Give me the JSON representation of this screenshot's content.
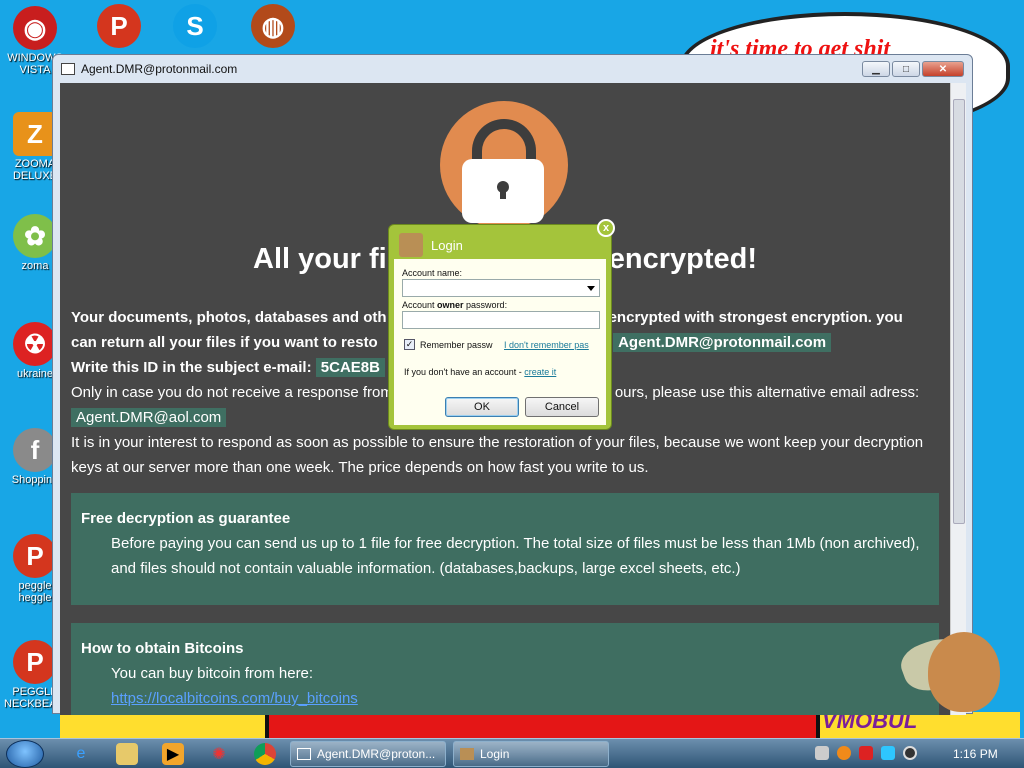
{
  "desktop": {
    "icons": [
      {
        "label": "WINDOWS VISTA",
        "glyph": "◉",
        "color": "#c81e1e"
      },
      {
        "label": "ZOOMA DELUXE",
        "glyph": "Z",
        "color": "#e8921a"
      },
      {
        "label": "zoma",
        "glyph": "✿",
        "color": "#7fbf4a"
      },
      {
        "label": "ukraine",
        "glyph": "☢",
        "color": "#d22"
      },
      {
        "label": "Shopping",
        "glyph": "f",
        "color": "#8a8a8a"
      },
      {
        "label": "peggle heggle",
        "glyph": "P",
        "color": "#d4361e"
      },
      {
        "label": "PEGGLE NECKBEARD",
        "glyph": "P",
        "color": "#d4361e"
      }
    ],
    "top_icons": [
      {
        "glyph": "P",
        "color": "#d4361e"
      },
      {
        "glyph": "S",
        "color": "#0fa1e6"
      },
      {
        "glyph": "◍",
        "color": "#b24a1a"
      }
    ],
    "cloud_text": "it's time to get shit",
    "cartoon_word": "VMOBUL"
  },
  "window": {
    "title": "Agent.DMR@protonmail.com",
    "controls": {
      "minimize": "▁",
      "maximize": "□",
      "close": "✕"
    }
  },
  "ransom": {
    "headline_left": "All your fi",
    "headline_right": "encrypted!",
    "p1_a": "Your documents, photos, databases and oth",
    "p1_b": "encrypted with strongest encryption. you",
    "p2_a": "can return all your files if you want to resto",
    "p2_b": "l:",
    "email_primary": "Agent.DMR@protonmail.com",
    "p3_a": "Write this ID in the subject e-mail:",
    "id_partial": "5CAE8B",
    "p4_a": "Only in case you do not receive a response from",
    "p4_b": "ours, please use this alternative email adress:",
    "email_alt": "Agent.DMR@aol.com",
    "p5": "It is in your interest to respond as soon as possible to ensure the restoration of your files, because we wont keep your decryption keys at our server more than one week. The price depends on how fast you write to us.",
    "free": {
      "title": "Free decryption as guarantee",
      "text": "Before paying you can send us up to 1 file for free decryption. The total size of files must be less than 1Mb (non archived), and files should not contain valuable information. (databases,backups, large excel sheets, etc.)"
    },
    "bitcoin": {
      "title": "How to obtain Bitcoins",
      "text": "You can buy bitcoin from here:",
      "link": "https://localbitcoins.com/buy_bitcoins"
    }
  },
  "login": {
    "title": "Login",
    "close": "x",
    "account_label": "Account name:",
    "password_label_a": "Account ",
    "password_label_b": "owner",
    "password_label_c": " password:",
    "remember": "Remember passw",
    "forgot": "I don't remember pas",
    "no_account": "If you don't have an account - ",
    "create": "create it",
    "ok": "OK",
    "cancel": "Cancel"
  },
  "taskbar": {
    "tasks": [
      {
        "label": "Agent.DMR@proton..."
      },
      {
        "label": "Login"
      }
    ],
    "clock": "1:16 PM"
  }
}
